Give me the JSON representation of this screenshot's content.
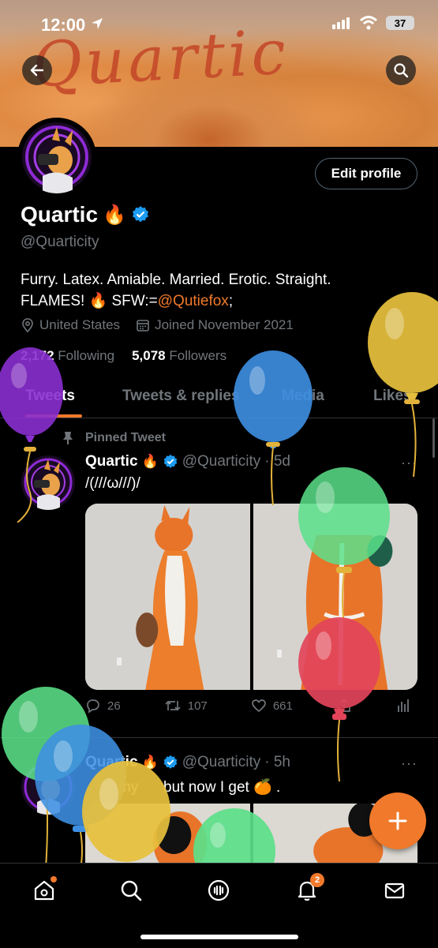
{
  "status_bar": {
    "time": "12:00",
    "battery": "37"
  },
  "banner": {
    "text": "Quartic"
  },
  "profile": {
    "edit_button": "Edit profile",
    "name": "Quartic",
    "name_emoji": "🔥",
    "handle": "@Quarticity",
    "bio_line1": "Furry. Latex. Amiable. Married. Erotic. Straight.",
    "bio_line2_prefix": "FLAMES! 🔥 SFW:=",
    "bio_mention": "@Qutiefox",
    "bio_line2_suffix": ";",
    "location": "United States",
    "joined": "Joined November 2021",
    "following_count": "2,172",
    "following_label": "Following",
    "followers_count": "5,078",
    "followers_label": "Followers"
  },
  "tabs": [
    {
      "label": "Tweets"
    },
    {
      "label": "Tweets & replies"
    },
    {
      "label": "Media"
    },
    {
      "label": "Likes"
    }
  ],
  "tweets": [
    {
      "pinned_label": "Pinned Tweet",
      "name": "Quartic",
      "emoji": "🔥",
      "handle": "@Quarticity",
      "time": "· 5d",
      "text": "/(///ω///)/",
      "replies": "26",
      "retweets": "107",
      "likes": "661"
    },
    {
      "name": "Quartic",
      "emoji": "🔥",
      "handle": "@Quarticity",
      "time": "· 5h",
      "text": "my      but now I get 🍊 ."
    }
  ],
  "more_label": "···",
  "colors": {
    "accent": "#f0792b",
    "verified": "#1d9bf0",
    "muted": "#71767b"
  },
  "icons": {
    "back": "arrow-left-icon",
    "search": "search-icon",
    "compose": "plus-icon",
    "nav": [
      "home-icon",
      "search-icon",
      "spaces-icon",
      "notifications-icon",
      "messages-icon"
    ]
  },
  "notifications_badge": "2"
}
